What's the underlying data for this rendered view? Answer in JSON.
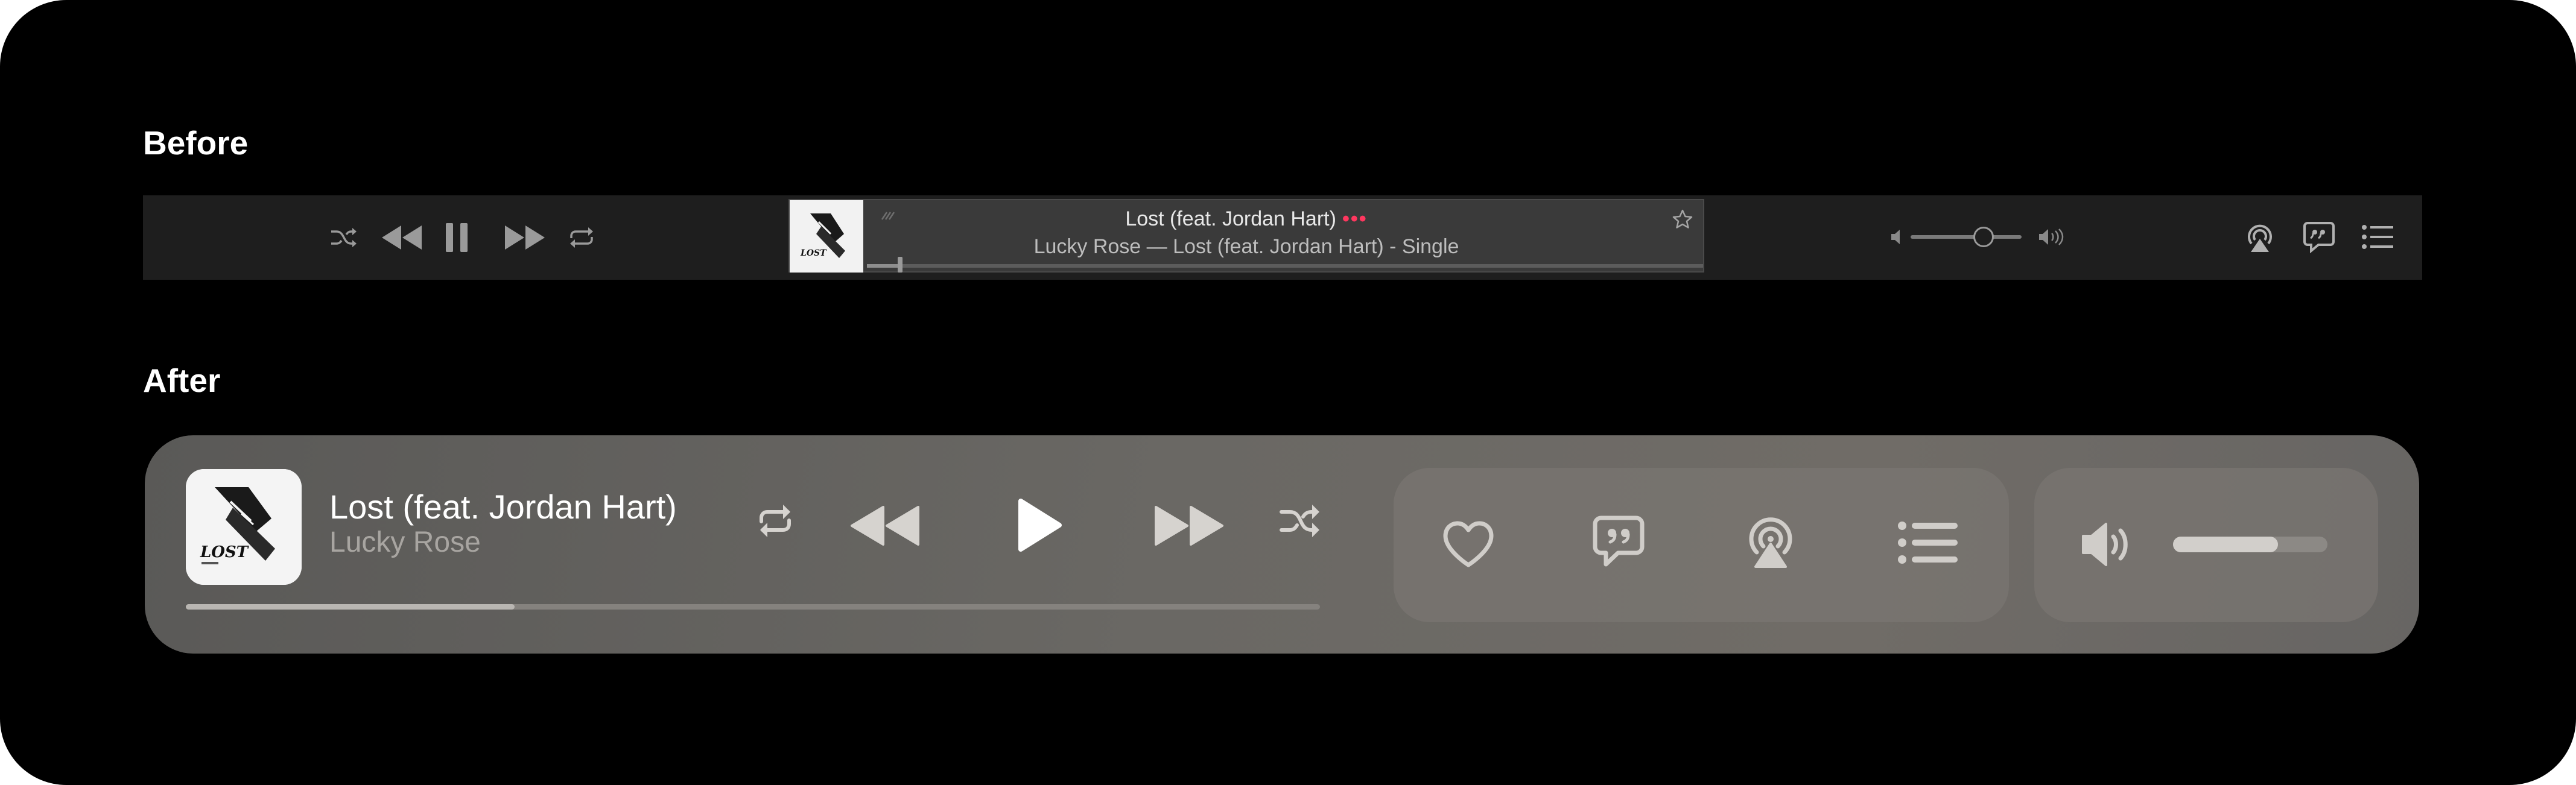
{
  "sections": {
    "before_label": "Before",
    "after_label": "After"
  },
  "before": {
    "now_playing": {
      "title": "Lost (feat. Jordan Hart)",
      "more_dots": "•••",
      "subtitle": "Lucky Rose — Lost (feat. Jordan Hart) - Single",
      "progress": 0.04
    },
    "volume_level": 0.66,
    "icons": [
      "shuffle-icon",
      "rewind-icon",
      "pause-icon",
      "fast-forward-icon",
      "repeat-icon",
      "airplay-icon",
      "lyrics-icon",
      "queue-icon",
      "star-icon",
      "volume-low-icon",
      "volume-high-icon"
    ]
  },
  "after": {
    "title": "Lost (feat. Jordan Hart)",
    "artist": "Lucky Rose",
    "progress": 0.29,
    "volume_level": 0.68,
    "icons": [
      "repeat-icon",
      "rewind-icon",
      "play-icon",
      "fast-forward-icon",
      "shuffle-icon",
      "heart-icon",
      "lyrics-icon",
      "airplay-icon",
      "queue-icon",
      "volume-icon"
    ]
  },
  "album_art": {
    "text": "LOST"
  },
  "colors": {
    "accent_dots": "#ff375f",
    "before_bar": "#1e1e1e",
    "after_bar": "#6a6864"
  }
}
